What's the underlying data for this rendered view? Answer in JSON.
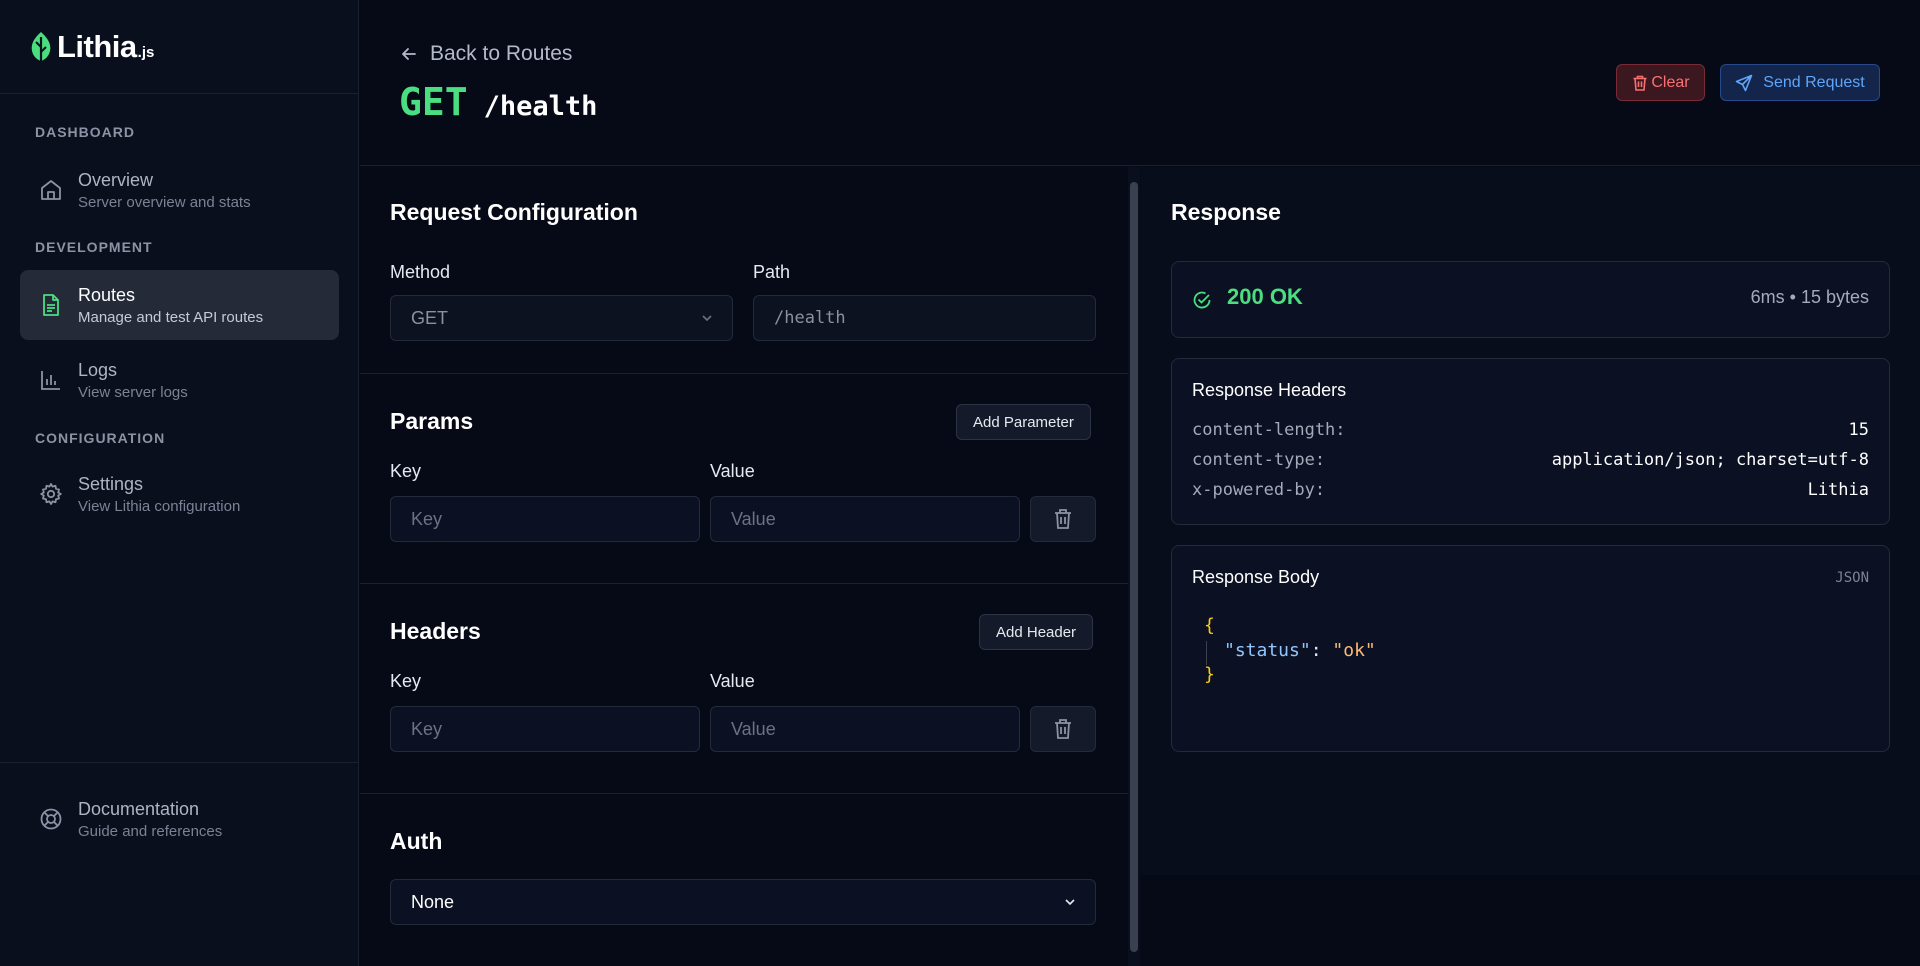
{
  "logo": {
    "word": "Lithia",
    "suffix": ".js"
  },
  "sidebar": {
    "sections": [
      {
        "title": "DASHBOARD"
      },
      {
        "title": "DEVELOPMENT"
      },
      {
        "title": "CONFIGURATION"
      }
    ],
    "items": [
      {
        "title": "Overview",
        "subtitle": "Server overview and stats"
      },
      {
        "title": "Routes",
        "subtitle": "Manage and test API routes"
      },
      {
        "title": "Logs",
        "subtitle": "View server logs"
      },
      {
        "title": "Settings",
        "subtitle": "View Lithia configuration"
      },
      {
        "title": "Documentation",
        "subtitle": "Guide and references"
      }
    ]
  },
  "header": {
    "back_label": "Back to Routes",
    "method": "GET",
    "path": "/health",
    "clear_label": "Clear",
    "send_label": "Send Request"
  },
  "request": {
    "title": "Request Configuration",
    "method_label": "Method",
    "method_value": "GET",
    "path_label": "Path",
    "path_value": "/health"
  },
  "params": {
    "title": "Params",
    "add_label": "Add Parameter",
    "key_label": "Key",
    "value_label": "Value",
    "key_placeholder": "Key",
    "value_placeholder": "Value"
  },
  "headers": {
    "title": "Headers",
    "add_label": "Add Header",
    "key_label": "Key",
    "value_label": "Value",
    "key_placeholder": "Key",
    "value_placeholder": "Value"
  },
  "auth": {
    "title": "Auth",
    "value": "None"
  },
  "response": {
    "title": "Response",
    "status": "200 OK",
    "meta": "6ms • 15 bytes",
    "headers_title": "Response Headers",
    "headers": [
      {
        "key": "content-length:",
        "value": "15"
      },
      {
        "key": "content-type:",
        "value": "application/json; charset=utf-8"
      },
      {
        "key": "x-powered-by:",
        "value": "Lithia"
      }
    ],
    "body_title": "Response Body",
    "body_format": "JSON",
    "body": {
      "open": "{",
      "key": "\"status\"",
      "colon": ":",
      "value": "\"ok\"",
      "close": "}"
    }
  },
  "colors": {
    "accent_green": "#4ade80",
    "accent_blue": "#60a5fa",
    "danger": "#f87171",
    "background": "#060a17"
  }
}
